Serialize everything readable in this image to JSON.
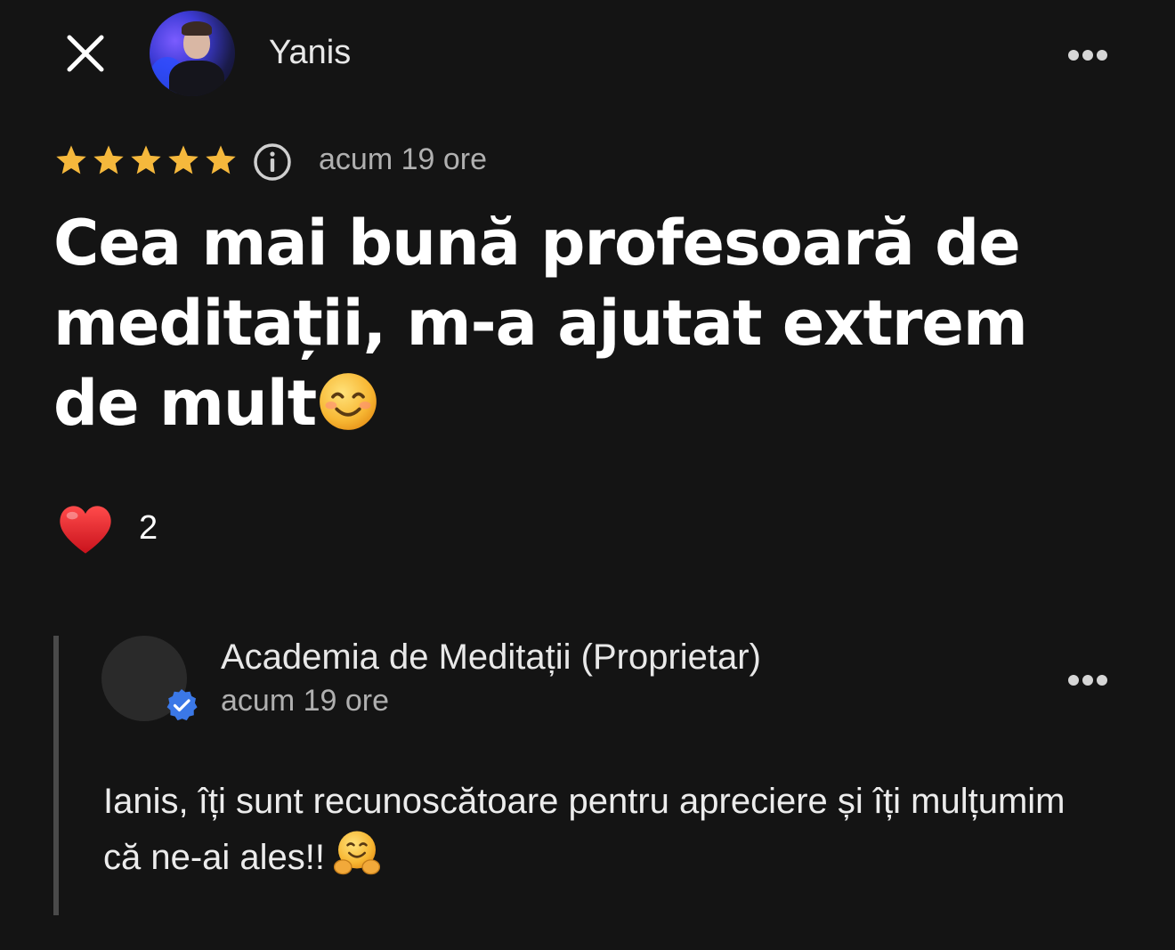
{
  "header": {
    "user_name": "Yanis"
  },
  "review": {
    "rating": 5,
    "max_rating": 5,
    "time": "acum 19 ore",
    "text": "Cea mai bună profesoară de meditații, m-a ajutat extrem de mult",
    "text_emoji": "smiling-face-icon",
    "reaction": {
      "icon": "heart-icon",
      "count": "2"
    }
  },
  "owner_reply": {
    "name": "Academia de Meditații (Proprietar)",
    "time": "acum 19 ore",
    "text": "Ianis, îți sunt recunoscătoare pentru apreciere și îți mulțumim că ne-ai ales!!",
    "text_emoji": "hugging-face-icon",
    "badge": "verified-icon"
  },
  "colors": {
    "background": "#141414",
    "star": "#f5b83c",
    "verified": "#3b78e7",
    "heart": "#e0232d"
  }
}
